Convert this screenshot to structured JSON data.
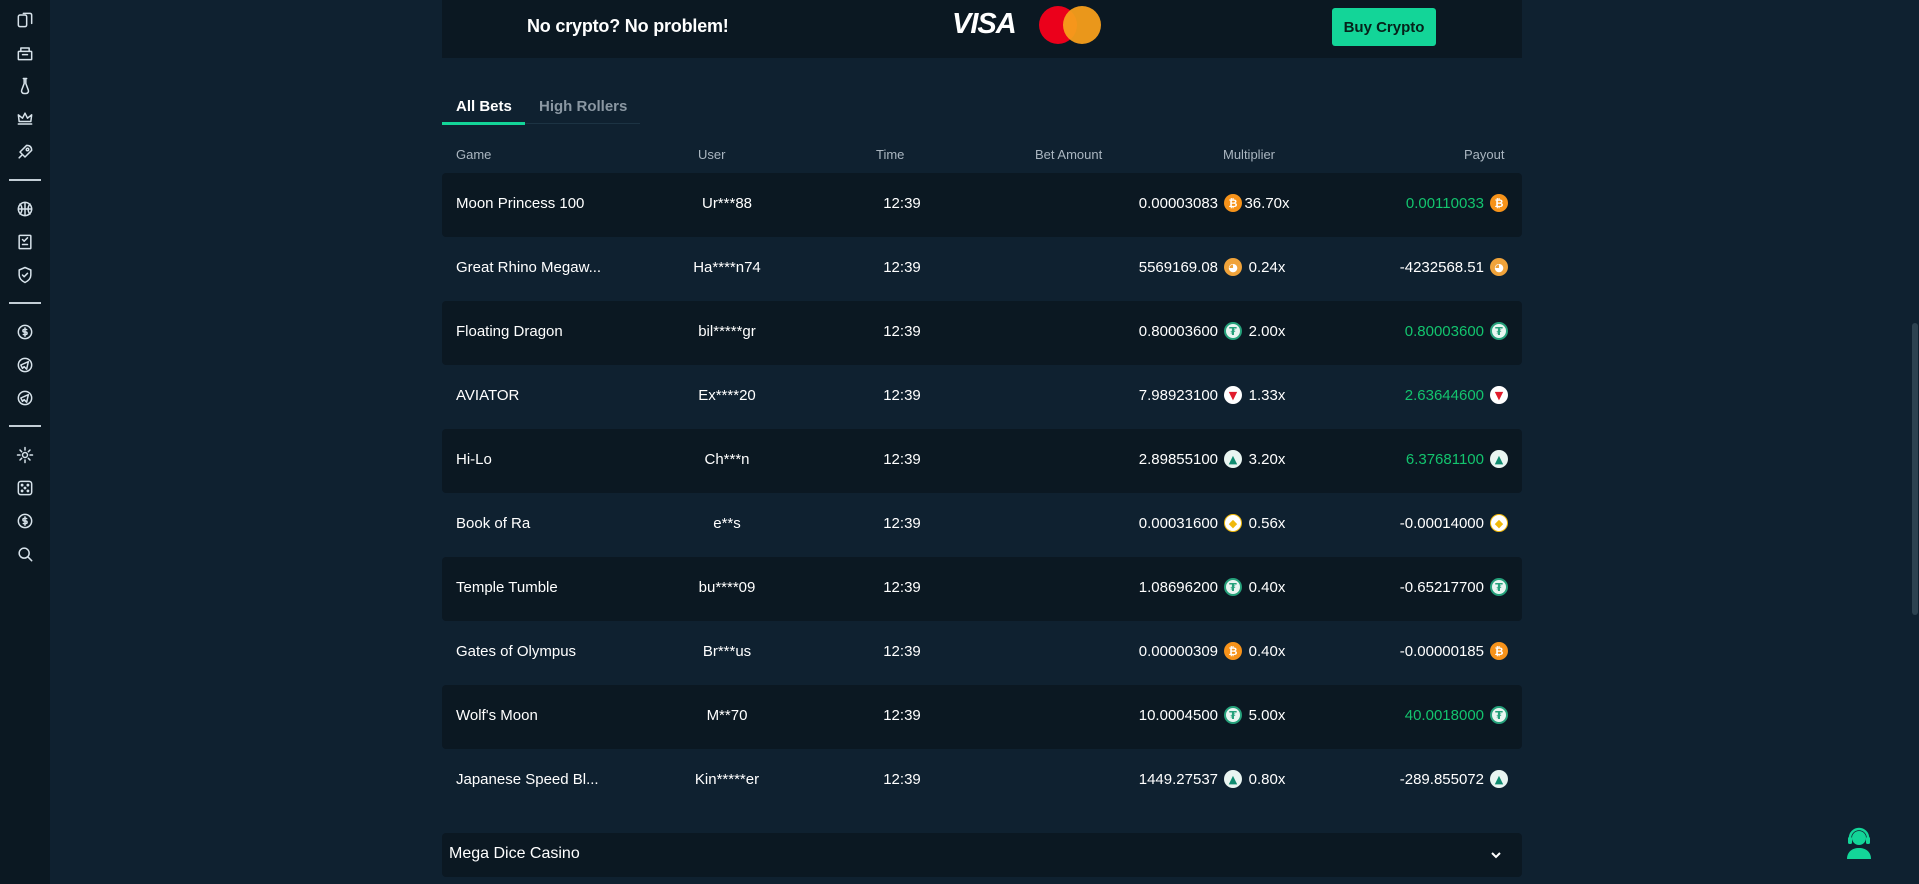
{
  "sidebar": {
    "groups": [
      [
        "cards-icon",
        "casino-chips-icon",
        "potion-icon",
        "crown-icon",
        "rocket-icon"
      ],
      [
        "basketball-icon",
        "coupon-icon",
        "shield-icon"
      ],
      [
        "dollar-coin-icon",
        "telegram-icon",
        "telegram-alt-icon"
      ],
      [
        "settings-icon",
        "dice-icon",
        "dollar-icon",
        "search-icon"
      ]
    ]
  },
  "promo": {
    "text": "No crypto? No problem!",
    "visa": "VISA",
    "button": "Buy Crypto"
  },
  "tabs": {
    "all": "All Bets",
    "high": "High Rollers"
  },
  "headers": {
    "game": "Game",
    "user": "User",
    "time": "Time",
    "bet": "Bet Amount",
    "mult": "Multiplier",
    "payout": "Payout"
  },
  "bets": [
    {
      "game": "Moon Princess 100",
      "user": "Ur***88",
      "time": "12:39",
      "bet": "0.00003083",
      "coin": "btc",
      "mult": "36.70x",
      "payout": "0.00110033",
      "positive": true
    },
    {
      "game": "Great Rhino Megaw...",
      "user": "Ha****n74",
      "time": "12:39",
      "bet": "5569169.08",
      "coin": "shib",
      "mult": "0.24x",
      "payout": "-4232568.51",
      "positive": false
    },
    {
      "game": "Floating Dragon",
      "user": "bil*****gr",
      "time": "12:39",
      "bet": "0.80003600",
      "coin": "usdt",
      "mult": "2.00x",
      "payout": "0.80003600",
      "positive": true
    },
    {
      "game": "AVIATOR",
      "user": "Ex****20",
      "time": "12:39",
      "bet": "7.98923100",
      "coin": "trx",
      "mult": "1.33x",
      "payout": "2.63644600",
      "positive": true
    },
    {
      "game": "Hi-Lo",
      "user": "Ch***n",
      "time": "12:39",
      "bet": "2.89855100",
      "coin": "tri",
      "mult": "3.20x",
      "payout": "6.37681100",
      "positive": true
    },
    {
      "game": "Book of Ra",
      "user": "e**s",
      "time": "12:39",
      "bet": "0.00031600",
      "coin": "bnb",
      "mult": "0.56x",
      "payout": "-0.00014000",
      "positive": false
    },
    {
      "game": "Temple Tumble",
      "user": "bu****09",
      "time": "12:39",
      "bet": "1.08696200",
      "coin": "usdt",
      "mult": "0.40x",
      "payout": "-0.65217700",
      "positive": false
    },
    {
      "game": "Gates of Olympus",
      "user": "Br***us",
      "time": "12:39",
      "bet": "0.00000309",
      "coin": "btc",
      "mult": "0.40x",
      "payout": "-0.00000185",
      "positive": false
    },
    {
      "game": "Wolf's Moon",
      "user": "M**70",
      "time": "12:39",
      "bet": "10.0004500",
      "coin": "usdt",
      "mult": "5.00x",
      "payout": "40.0018000",
      "positive": true
    },
    {
      "game": "Japanese Speed Bl...",
      "user": "Kin*****er",
      "time": "12:39",
      "bet": "1449.27537",
      "coin": "tri",
      "mult": "0.80x",
      "payout": "-289.855072",
      "positive": false
    }
  ],
  "coin_glyphs": {
    "btc": "₿",
    "shib": "◕",
    "usdt": "₮",
    "trx": "▼",
    "tri": "▲",
    "bnb": "◆"
  },
  "footer": {
    "title": "Mega Dice Casino"
  },
  "colors": {
    "accent": "#13d598",
    "positive": "#13c46e",
    "background": "#0f2130",
    "panel": "#0b1822"
  }
}
